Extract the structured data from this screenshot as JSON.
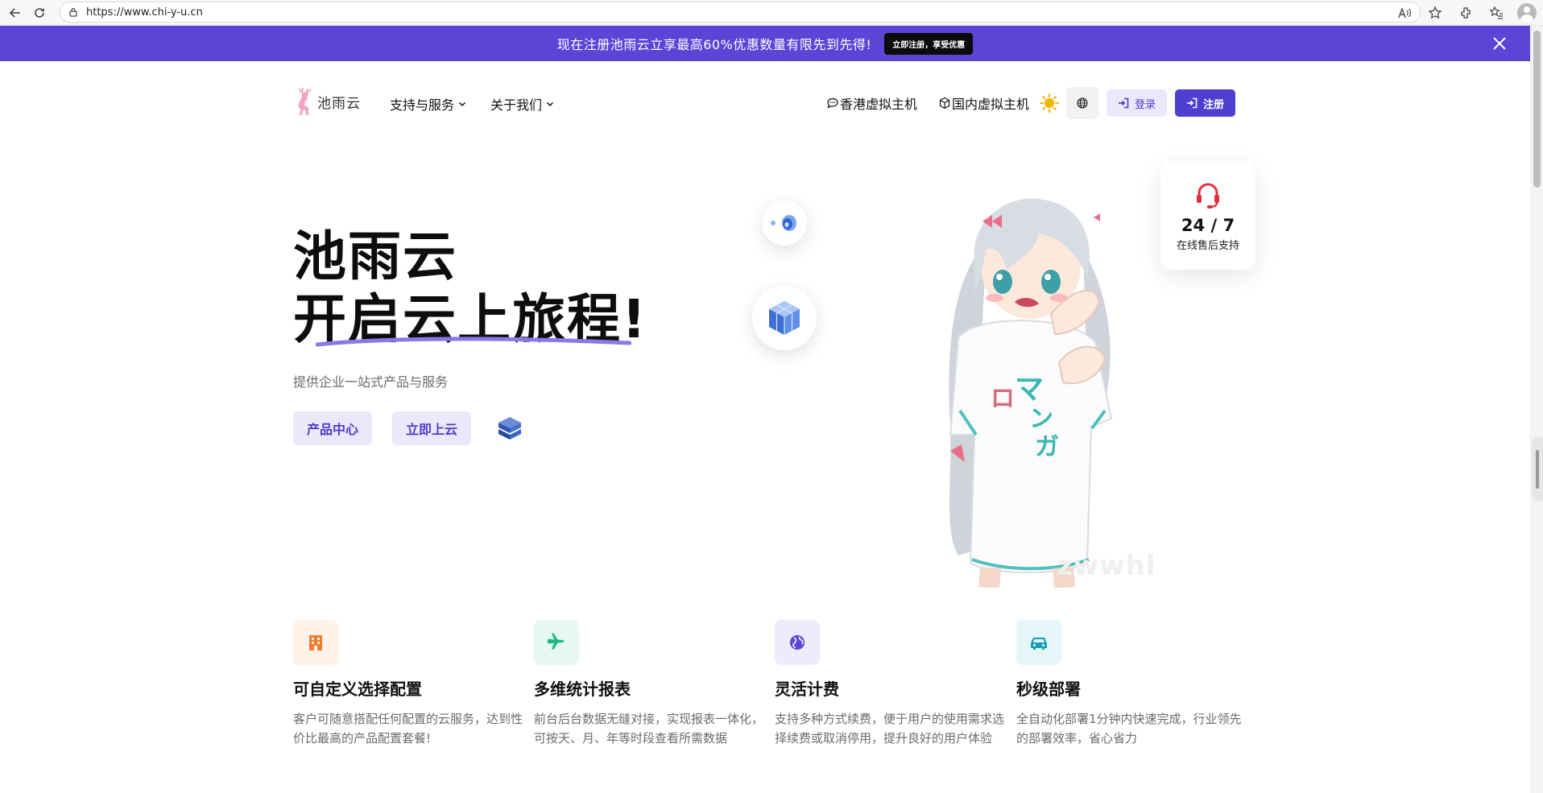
{
  "browser": {
    "url": "https://www.chi-y-u.cn"
  },
  "promo": {
    "text": "现在注册池雨云立享最高60%优惠数量有限先到先得!",
    "button": "立即注册，享受优惠"
  },
  "header": {
    "logo_text": "池雨云",
    "menu": [
      {
        "label": "支持与服务"
      },
      {
        "label": "关于我们"
      }
    ],
    "links": [
      {
        "label": "香港虚拟主机"
      },
      {
        "label": "国内虚拟主机"
      }
    ],
    "login": "登录",
    "register": "注册"
  },
  "hero": {
    "title_line1": "池雨云",
    "title_line2": "开启云上旅程!",
    "subtitle": "提供企业一站式产品与服务",
    "btn_products": "产品中心",
    "btn_start": "立即上云"
  },
  "support": {
    "big": "24 / 7",
    "small": "在线售后支持"
  },
  "watermark": "zwwhl",
  "features": [
    {
      "title": "可自定义选择配置",
      "desc": "客户可随意搭配任何配置的云服务，达到性价比最高的产品配置套餐!",
      "icon": "building-icon",
      "color": "#f07c2c",
      "bg": "#fff2e8"
    },
    {
      "title": "多维统计报表",
      "desc": "前台后台数据无缝对接，实现报表一体化，可按天、月、年等时段查看所需数据",
      "icon": "plane-icon",
      "color": "#1bb885",
      "bg": "#e6f8f1"
    },
    {
      "title": "灵活计费",
      "desc": "支持多种方式续费，便于用户的使用需求选择续费或取消停用，提升良好的用户体验",
      "icon": "globe-icon",
      "color": "#5a45d6",
      "bg": "#eeebfb"
    },
    {
      "title": "秒级部署",
      "desc": "全自动化部署1分钟内快速完成，行业领先的部署效率，省心省力",
      "icon": "car-icon",
      "color": "#1c9fb3",
      "bg": "#e5f6f8"
    }
  ],
  "colors": {
    "brand": "#5a45d6",
    "brand_dark": "#4e3fd0",
    "brand_light": "#ebe8fb"
  }
}
